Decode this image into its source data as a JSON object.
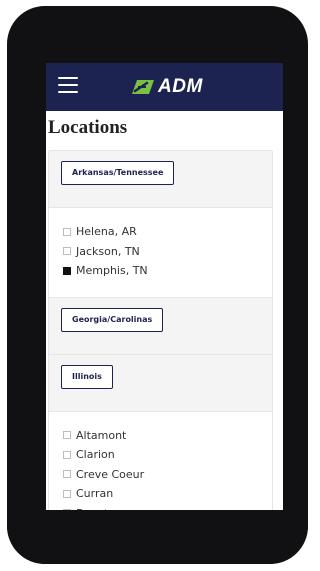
{
  "header": {
    "logo_text": "ADM",
    "menu_icon": "hamburger-icon",
    "logo_icon": "adm-leaf-logo-icon"
  },
  "page": {
    "title": "Locations"
  },
  "groups": [
    {
      "label": "Arkansas/Tennessee",
      "locations": [
        {
          "name": "Helena, AR",
          "checked": false
        },
        {
          "name": "Jackson, TN",
          "checked": false
        },
        {
          "name": "Memphis, TN",
          "checked": true
        }
      ]
    },
    {
      "label": "Georgia/Carolinas",
      "locations": []
    },
    {
      "label": "Illinois",
      "locations": [
        {
          "name": "Altamont",
          "checked": false
        },
        {
          "name": "Clarion",
          "checked": false
        },
        {
          "name": "Creve Coeur",
          "checked": false
        },
        {
          "name": "Curran",
          "checked": false
        },
        {
          "name": "Decatur",
          "checked": false
        }
      ]
    }
  ],
  "colors": {
    "navbar": "#1d2350",
    "accent": "#1d2350",
    "logo_green": "#7ac143",
    "checked": "#111111"
  }
}
